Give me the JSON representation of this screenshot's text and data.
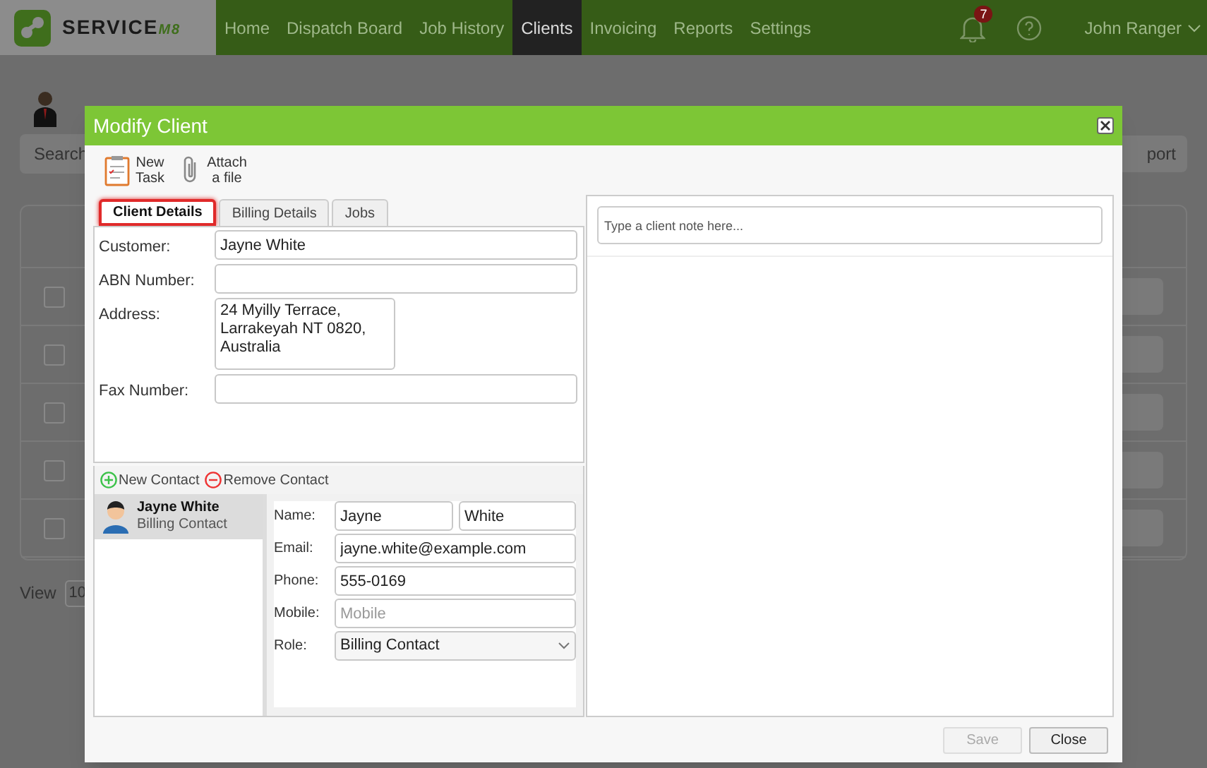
{
  "nav": {
    "brand": "SERVICE",
    "brand_suffix": "M8",
    "items": [
      {
        "label": "Home",
        "selected": false
      },
      {
        "label": "Dispatch Board",
        "selected": false
      },
      {
        "label": "Job History",
        "selected": false
      },
      {
        "label": "Clients",
        "selected": true
      },
      {
        "label": "Invoicing",
        "selected": false
      },
      {
        "label": "Reports",
        "selected": false
      },
      {
        "label": "Settings",
        "selected": false
      }
    ],
    "notifications": "7",
    "user": "John Ranger"
  },
  "background": {
    "search_placeholder": "Search",
    "export_label": "port",
    "view_label": "View",
    "view_value": "10",
    "rows": [
      {
        "checked": false
      },
      {
        "checked": false
      },
      {
        "checked": false
      },
      {
        "checked": false
      },
      {
        "checked": false
      }
    ]
  },
  "dialog": {
    "title": "Modify Client",
    "toolbar": [
      {
        "kind": "task",
        "lines": [
          "New",
          "Task"
        ]
      },
      {
        "kind": "attach",
        "lines": [
          "Attach",
          "a file"
        ]
      }
    ],
    "tabs": [
      {
        "label": "Client Details",
        "selected": true,
        "highlighted": true
      },
      {
        "label": "Billing Details",
        "selected": false,
        "highlighted": false
      },
      {
        "label": "Jobs",
        "selected": false,
        "highlighted": false
      }
    ],
    "fields": [
      {
        "label": "Customer:",
        "kind": "input",
        "value": "Jayne White"
      },
      {
        "label": "ABN Number:",
        "kind": "input"
      },
      {
        "label": "Address:",
        "kind": "textarea",
        "lines": [
          "24 Myilly Terrace,",
          "Larrakeyah NT 0820,",
          "Australia"
        ]
      },
      {
        "label": "Fax Number:",
        "kind": "input"
      }
    ],
    "contact_actions": [
      {
        "kind": "add",
        "label": "New Contact"
      },
      {
        "kind": "remove",
        "label": "Remove Contact"
      }
    ],
    "contacts": [
      {
        "name": "Jayne White",
        "role": "Billing Contact",
        "selected": true
      }
    ],
    "contact_form": [
      {
        "label": "Name:",
        "kind": "name",
        "first": "Jayne",
        "last": "White"
      },
      {
        "label": "Email:",
        "kind": "input",
        "value": "jayne.white@example.com"
      },
      {
        "label": "Phone:",
        "kind": "input",
        "value": "555-0169"
      },
      {
        "label": "Mobile:",
        "kind": "input",
        "placeholder": "Mobile"
      },
      {
        "label": "Role:",
        "kind": "select",
        "value": "Billing Contact"
      }
    ],
    "note_placeholder": "Type a client note here...",
    "buttons": [
      {
        "label": "Save",
        "disabled": true
      },
      {
        "label": "Close",
        "disabled": false
      }
    ]
  }
}
